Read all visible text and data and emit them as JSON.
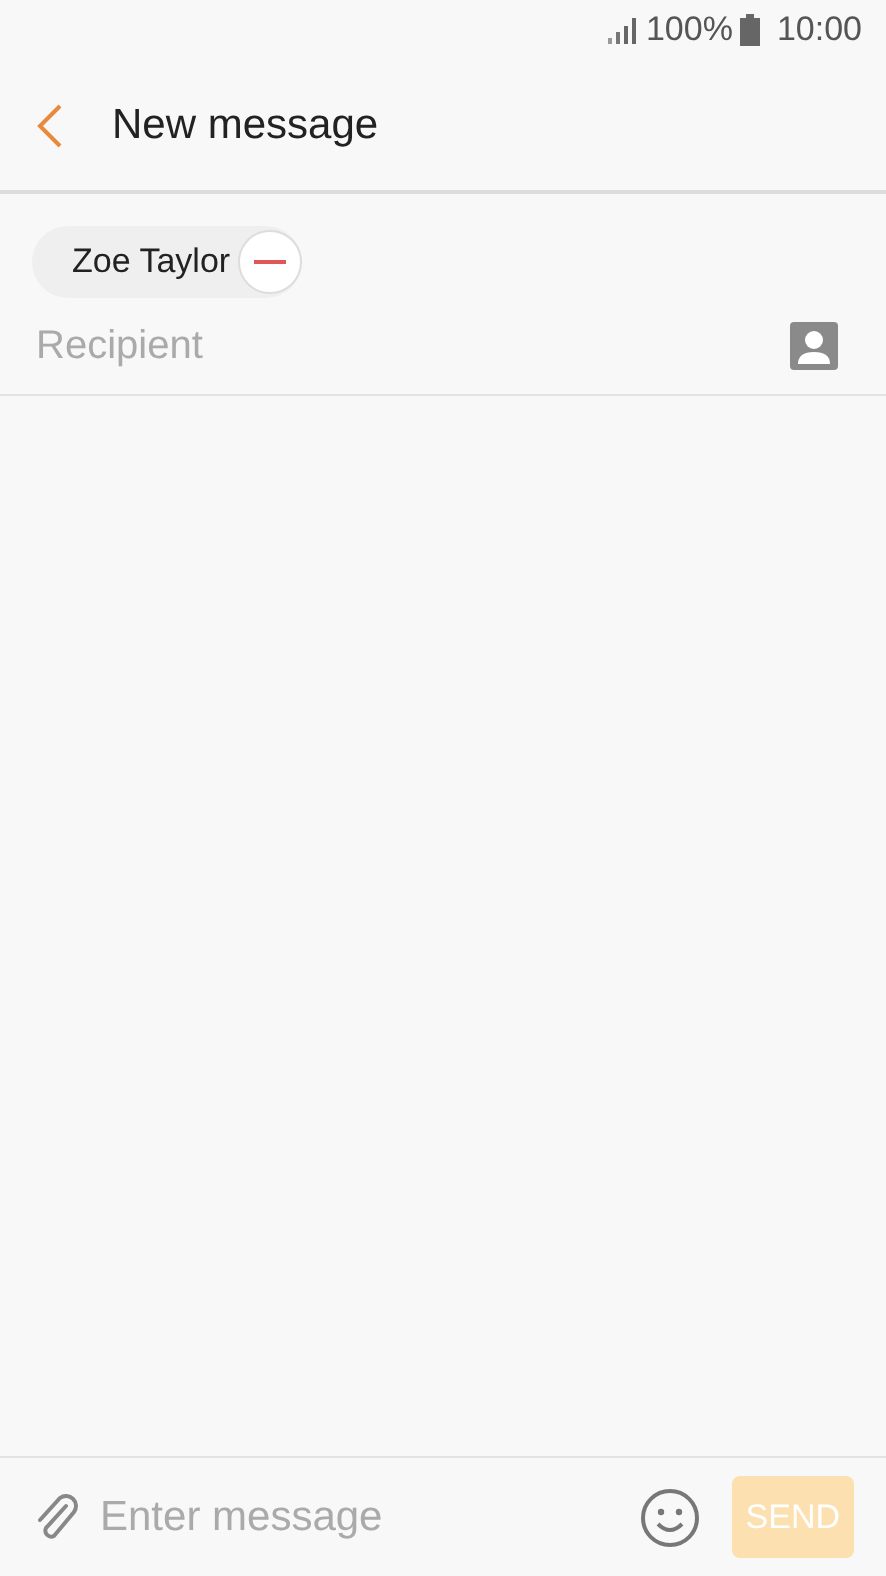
{
  "status_bar": {
    "battery": "100%",
    "time": "10:00"
  },
  "header": {
    "title": "New message"
  },
  "recipients": [
    {
      "name": "Zoe Taylor"
    }
  ],
  "recipient_field": {
    "placeholder": "Recipient"
  },
  "composer": {
    "placeholder": "Enter message",
    "send": {
      "label": "SEND",
      "disabled": true
    }
  }
}
